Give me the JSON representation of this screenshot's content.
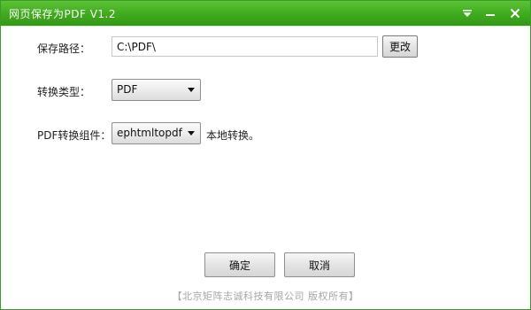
{
  "window": {
    "title": "网页保存为PDF  V1.2",
    "accent_color": "#3faa1e",
    "controls": {
      "dropdown_icon": "dropdown-arrow-icon",
      "minimize_icon": "minimize-icon",
      "close_icon": "close-icon"
    }
  },
  "form": {
    "path_label": "保存路径：",
    "path_value": "C:\\PDF\\",
    "change_button": "更改",
    "type_label": "转换类型：",
    "type_selected": "PDF",
    "component_label": "PDF转换组件：",
    "component_selected": "ephtmltopdf",
    "component_note": "本地转换。"
  },
  "actions": {
    "ok_label": "确定",
    "cancel_label": "取消"
  },
  "footer": {
    "copyright": "【北京矩阵志诚科技有限公司 版权所有】"
  }
}
